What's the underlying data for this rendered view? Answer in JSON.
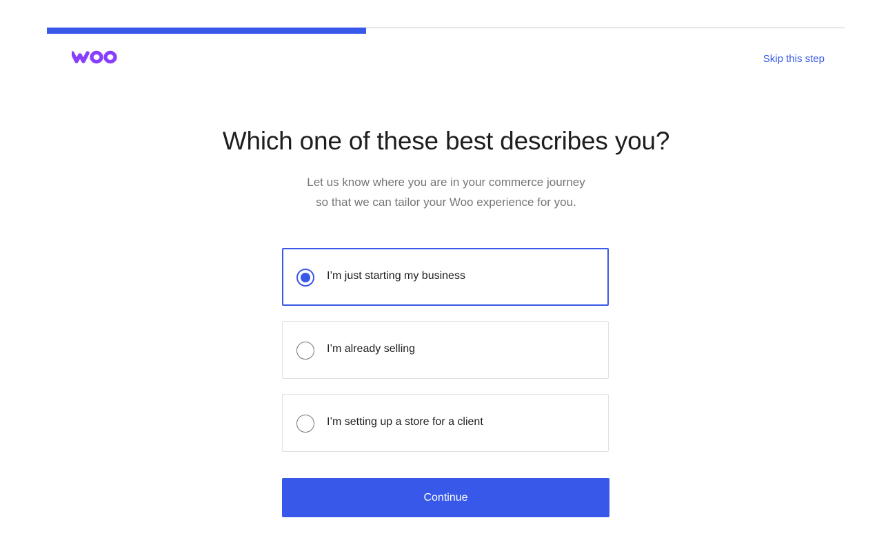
{
  "progress": {
    "fraction": 0.4
  },
  "header": {
    "logo_text": "woo",
    "logo_color": "#873eff",
    "skip_label": "Skip this step"
  },
  "main": {
    "title": "Which one of these best describes you?",
    "subtitle_line1": "Let us know where you are in your commerce journey",
    "subtitle_line2": "so that we can tailor your Woo experience for you.",
    "options": [
      {
        "label": "I’m just starting my business",
        "selected": true
      },
      {
        "label": "I’m already selling",
        "selected": false
      },
      {
        "label": "I’m setting up a store for a client",
        "selected": false
      }
    ],
    "continue_label": "Continue"
  },
  "colors": {
    "accent": "#3858e9",
    "brand": "#873eff",
    "text": "#1e1e1e",
    "muted": "#757575"
  }
}
